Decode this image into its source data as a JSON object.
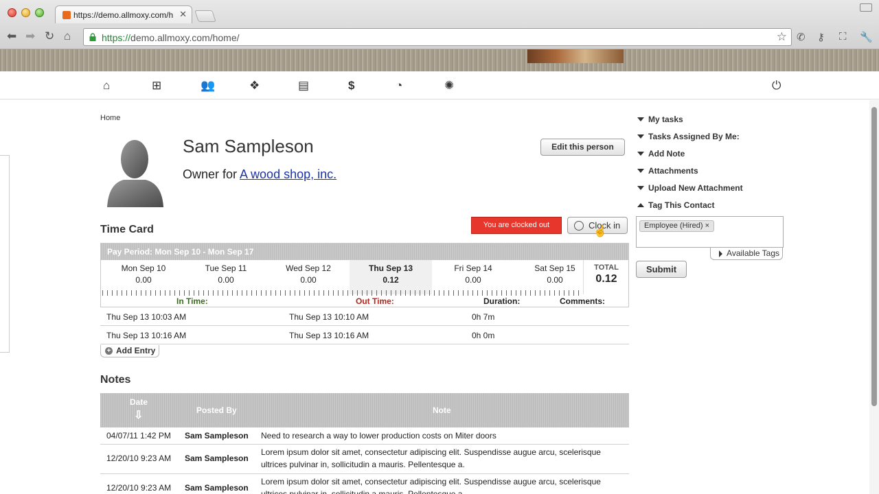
{
  "browser": {
    "tab_title": "https://demo.allmoxy.com/h",
    "url_scheme": "https://",
    "url_rest": "demo.allmoxy.com/home/"
  },
  "breadcrumb": "Home",
  "person": {
    "name": "Sam Sampleson",
    "role_prefix": "Owner for ",
    "company": "A wood shop, inc.",
    "edit_label": "Edit this person"
  },
  "timecard": {
    "title": "Time Card",
    "status": "You are clocked out",
    "clock_in_label": "Clock in",
    "pay_period": "Pay Period: Mon Sep 10 - Mon Sep 17",
    "days": [
      {
        "name": "Mon Sep 10",
        "value": "0.00"
      },
      {
        "name": "Tue Sep 11",
        "value": "0.00"
      },
      {
        "name": "Wed Sep 12",
        "value": "0.00"
      },
      {
        "name": "Thu Sep 13",
        "value": "0.12"
      },
      {
        "name": "Fri Sep 14",
        "value": "0.00"
      },
      {
        "name": "Sat Sep 15",
        "value": "0.00"
      }
    ],
    "total_label": "TOTAL",
    "total_value": "0.12",
    "headers": {
      "in_time": "In Time:",
      "out_time": "Out Time:",
      "duration": "Duration:",
      "comments": "Comments:"
    },
    "entries": [
      {
        "in": "Thu Sep 13 10:03 AM",
        "out": "Thu Sep 13 10:10 AM",
        "duration": "0h 7m"
      },
      {
        "in": "Thu Sep 13 10:16 AM",
        "out": "Thu Sep 13 10:16 AM",
        "duration": "0h 0m"
      }
    ],
    "add_entry_label": "Add Entry"
  },
  "notes": {
    "title": "Notes",
    "headers": {
      "date": "Date",
      "posted_by": "Posted By",
      "note": "Note"
    },
    "rows": [
      {
        "date": "04/07/11 1:42 PM",
        "posted_by": "Sam Sampleson",
        "note": "Need to research a way to lower production costs on Miter doors"
      },
      {
        "date": "12/20/10 9:23 AM",
        "posted_by": "Sam Sampleson",
        "note": "Lorem ipsum dolor sit amet, consectetur adipiscing elit. Suspendisse augue arcu, scelerisque ultrices pulvinar in, sollicitudin a mauris. Pellentesque a."
      },
      {
        "date": "12/20/10 9:23 AM",
        "posted_by": "Sam Sampleson",
        "note": "Lorem ipsum dolor sit amet, consectetur adipiscing elit. Suspendisse augue arcu, scelerisque ultrices pulvinar in, sollicitudin a mauris. Pellentesque a."
      }
    ]
  },
  "sidebar": {
    "items": [
      "My tasks",
      "Tasks Assigned By Me:",
      "Add Note",
      "Attachments",
      "Upload New Attachment",
      "Tag This Contact"
    ],
    "tag": "Employee (Hired)",
    "available_tags_label": "Available Tags",
    "submit_label": "Submit"
  },
  "colors": {
    "status_red": "#e7372d",
    "link_blue": "#1a33a8",
    "out_time_red": "#b3261e",
    "in_time_green": "#3a6b1c"
  },
  "icons": {
    "nav": [
      "home-icon",
      "network-icon",
      "people-icon",
      "dropbox-icon",
      "printer-icon",
      "dollar-icon",
      "pie-chart-icon",
      "gear-icon",
      "power-icon"
    ]
  }
}
